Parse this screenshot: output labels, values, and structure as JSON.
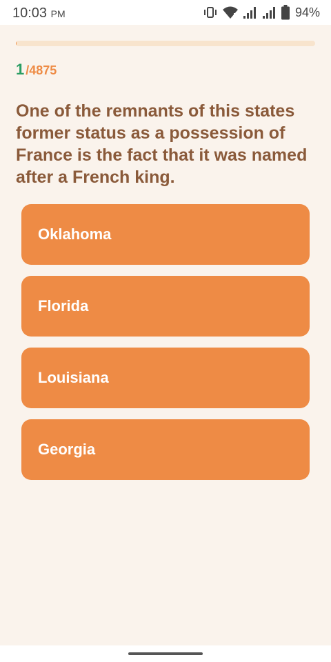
{
  "status_bar": {
    "time": "10:03",
    "ampm": "PM",
    "battery": "94%",
    "icons": [
      "vibrate-icon",
      "wifi-icon",
      "signal-icon",
      "signal-icon",
      "battery-icon"
    ]
  },
  "quiz": {
    "progress_fraction": 0.0002,
    "current_index": "1",
    "total": "/4875",
    "question": "One of the remnants of this states former status as a possession of France is the fact that it was named after a French king.",
    "answers": [
      "Oklahoma",
      "Florida",
      "Louisiana",
      "Georgia"
    ]
  },
  "colors": {
    "accent": "#ee8b45",
    "progress_track": "#f8e4cd",
    "current_index": "#2a9d63",
    "question_text": "#8a5a3a",
    "background": "#faf3ec"
  }
}
